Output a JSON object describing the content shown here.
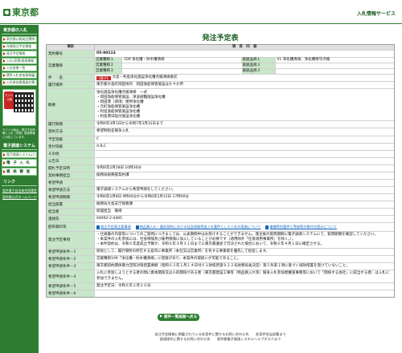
{
  "header": {
    "logo_text": "東京都",
    "service_title": "入札情報サービス"
  },
  "sidebar": {
    "section1_title": "東京都の入札",
    "items": [
      {
        "label": "東京都公報発注関係公告"
      },
      {
        "label": "年間発注予定情報"
      },
      {
        "label": "発注予定情報"
      },
      {
        "label": "入札(見積)経過情報"
      },
      {
        "label": "入札結果一覧"
      },
      {
        "label": "競争入札参加資格審査"
      },
      {
        "label": "入札参加資格者名簿"
      }
    ],
    "mobile_badge": "モバイル版",
    "qr_caption": "モバイル版は、発注予定情報と入札（見積）経過情報に対応しています。",
    "section2_title": "電子調達システム",
    "sys_items": [
      {
        "label": "電子調達システム(TOP)"
      },
      {
        "label": "電 子 入 札"
      },
      {
        "label": "資 格 審 査"
      }
    ],
    "section3_title": "リンク",
    "links": [
      {
        "label": "東京電子自治体共同運営"
      },
      {
        "label": "東京都公式ホームページ"
      }
    ]
  },
  "page": {
    "title": "発注予定表"
  },
  "table": {
    "header_item": "項目",
    "header_content": "項　目　内　容",
    "keys": {
      "contract_no": "契約番号",
      "business": "営業種目",
      "name": "件　　名",
      "location": "履行場所",
      "summary": "概要",
      "period": "履行期間",
      "method": "契約方法",
      "rank": "予定等級",
      "rank_grade": "受付等級",
      "other": "その他",
      "open_notice": "公告日",
      "open_date": "開札予定日時",
      "contract_dept": "契約事務担当",
      "desired_date": "希望申請",
      "desired_method": "希望申請方法",
      "desired_form": "担当部署",
      "contact_person": "担当者",
      "contact_tel": "連絡先",
      "docs": "配布資料等",
      "notes": "発注予定事項",
      "cond1": "希望申請条件－1",
      "cond2": "希望申請条件－2",
      "cond3": "希望申請条件－3",
      "cond4": "希望申請条件－4",
      "cond5": "希望申請条件－5",
      "cond6": "希望申請条件－6"
    },
    "contract_no": "05-90113",
    "business_rows": [
      {
        "k1": "営業種目１",
        "v1": "109 浄化槽・貯水槽清掃",
        "k2": "取扱品目１",
        "v2": "01 浄化槽清掃、浄化槽保守点検"
      },
      {
        "k1": "営業種目２",
        "v1": "",
        "k2": "取扱品目２",
        "v2": ""
      },
      {
        "k1": "営業種目３",
        "v1": "",
        "k2": "取扱品目３",
        "v2": ""
      }
    ],
    "denshi_label": "【電子】",
    "name": "大島・利島浄化施設浄化槽点検清掃委託",
    "location": "東京都大島町岡田地内　岡田漁船保管施設ほか４か所",
    "summary_lines": [
      "浄化施設浄化槽点検清掃　一式",
      "・岡田漁船保管施設、津波避難施設浄化槽",
      "・岡田港（環境）便所浄化槽",
      "・元町漁船保管施設浄化槽",
      "・利島漁船保管施設浄化槽",
      "・利島港日陰付施設浄化槽"
    ],
    "period": "令和6年4月1日から令和7年3月31日まで",
    "method": "希望制指名競争入札",
    "rank": "C",
    "rank_grade": "A,B,C",
    "other": "",
    "open_notice": "",
    "open_date": "令和6年2月28日 10時30分",
    "contract_dept": "総務局総務部契約課",
    "desired_date": "",
    "desired_method": "電子調達システムから希望申請をしてください。",
    "desired_form": "令和6年2月8日 9時00分から令和6年2月15日 17時00分",
    "contact_dept": "総務局大島支庁総務課",
    "contact_person": "経理担当　篠崎",
    "contact_tel": "04992-2-4485",
    "docs": [
      {
        "label": "発注予定表注意事項"
      },
      {
        "label": "物品買入れ・委託契約における社会保険等加入を要件とした入札の実施について"
      },
      {
        "label": "業種等別要件と等級等の格付の提示について"
      }
    ],
    "notes_lines": [
      "・仕様書の内容等についてのご質問につきましては、公表期間中はお受けすることができません。発注後の質問期間に電子調達システムにて、質問期間を確認してください。",
      "・本案件の入札参加には、社会保険及び雇用保険に加入していることが必要です（適用除外「任意適用事業所」を除く。）。",
      "・本件契約は、令和６年度成立予算が、令和６年３月３１日までに東京都議会で可決された場合において、令和６年４月１日に確定させる。"
    ],
    "cond1": "原則として、履行場所の所在する島内に事業所（本社又は営業所）を有する事業者を優先して指名します。",
    "cond2": "営業種目109「浄化槽・貯水槽清掃」に登録があり、本案件の取扱いが可能であること。",
    "cond3": "東京都契約関係暴力団等対策措置要綱（昭和６２年１月１４日付６１財経庶第９２２号財務局長決定）第５条第１項に基づく排除措置を受けていないこと。",
    "cond4": "入札に参加しようとする者の間に資本関係又は人的関係がある者（東京都建設工事等（物品買入れ等）競争入札参加者審査事務等において「関係する会社」に該当する者）は入札に参加できません。",
    "cond5": "発注予定日：令和６年２月２０日",
    "cond6": ""
  },
  "back_button": "案件一覧画面へ戻る",
  "footer": {
    "line1": "発注予定情報に掲載されている各案件に関するお問い合わせ先　　各案件担当部署まで",
    "line2": "調達操作に関するお問い合わせ先　　東京都電子調達システムヘルプデスクまで"
  }
}
